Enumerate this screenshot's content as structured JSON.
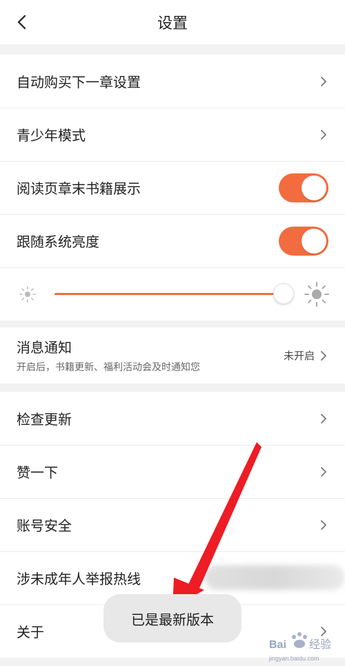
{
  "header": {
    "title": "设置"
  },
  "group1": [
    {
      "label": "自动购买下一章设置"
    },
    {
      "label": "青少年模式"
    }
  ],
  "group2": {
    "toggles": [
      {
        "label": "阅读页章末书籍展示",
        "on": true
      },
      {
        "label": "跟随系统亮度",
        "on": true
      }
    ],
    "brightness": {
      "level": 1.0
    }
  },
  "notify": {
    "title": "消息通知",
    "subtitle": "开启后，书籍更新、福利活动会及时通知您",
    "status": "未开启"
  },
  "group3": [
    {
      "label": "检查更新"
    },
    {
      "label": "赞一下"
    },
    {
      "label": "账号安全"
    },
    {
      "label": "涉未成年人举报热线"
    },
    {
      "label": "关于"
    }
  ],
  "toast": {
    "text": "已是最新版本"
  },
  "watermark": {
    "text": "Bai 经验",
    "sub": "jingyan.baidu.com"
  },
  "colors": {
    "accent": "#f26c3f",
    "annotation_arrow": "#ee1c24"
  }
}
